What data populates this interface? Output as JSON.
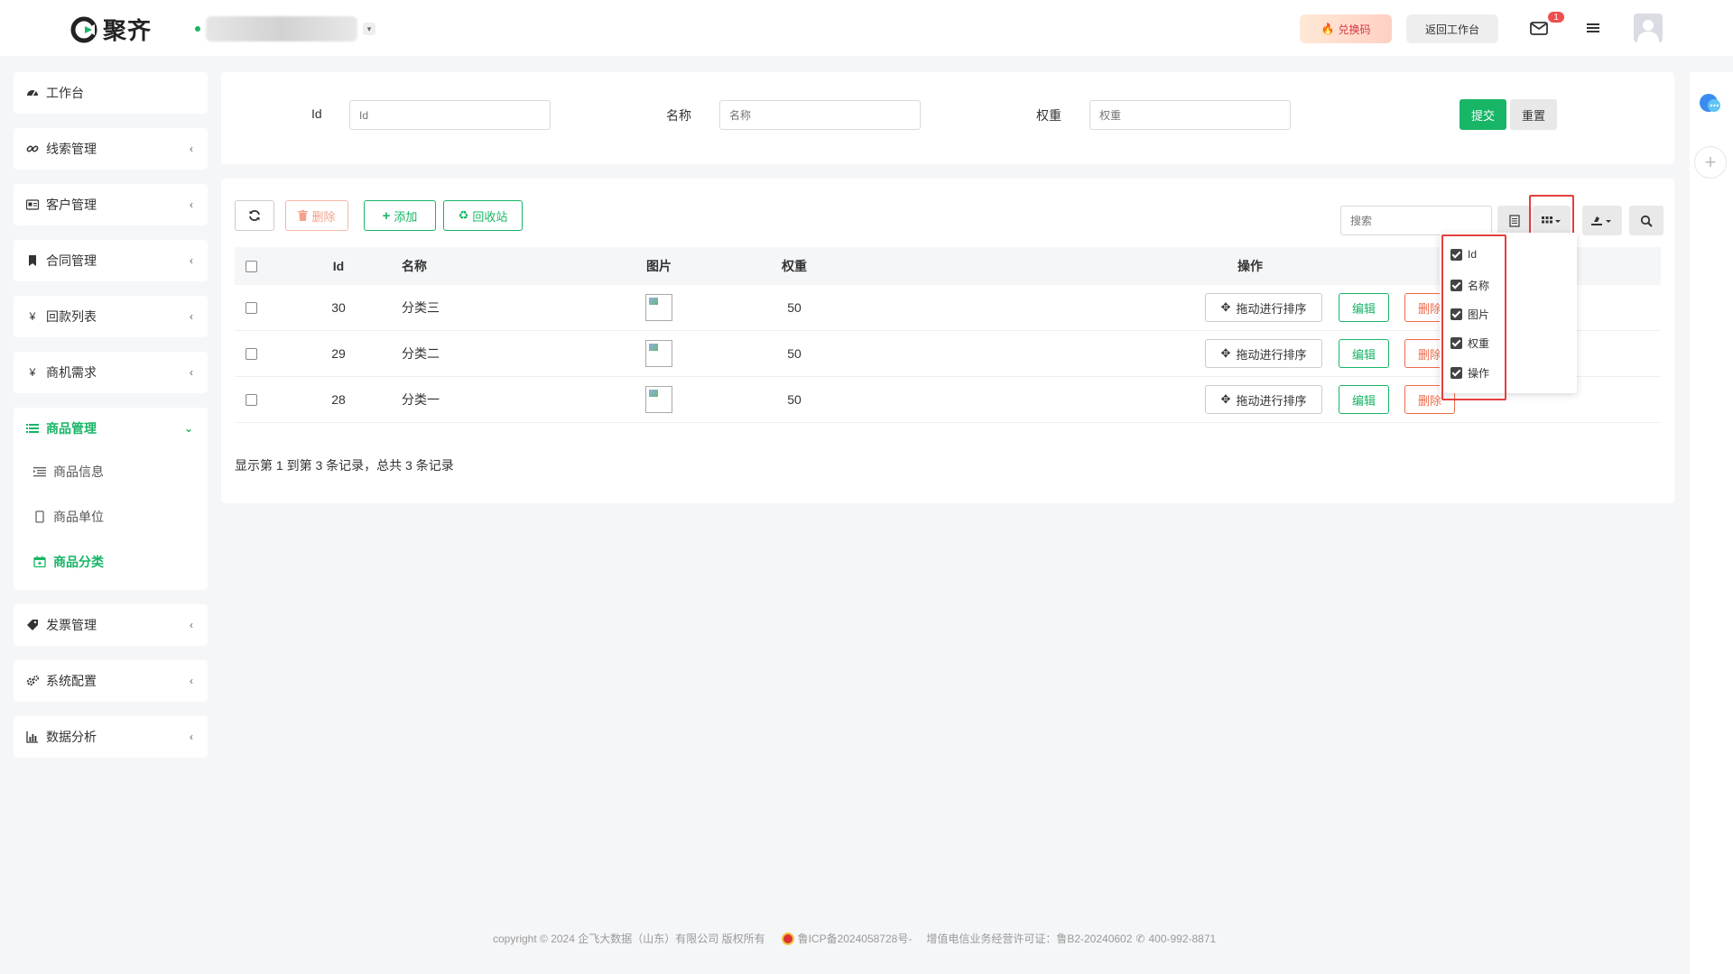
{
  "header": {
    "brand": "聚齐",
    "redeem_label": "兑换码",
    "return_label": "返回工作台",
    "mail_badge": "1"
  },
  "sidebar": {
    "items": [
      {
        "label": "工作台",
        "icon": "dashboard-icon"
      },
      {
        "label": "线索管理",
        "icon": "link-icon"
      },
      {
        "label": "客户管理",
        "icon": "id-card-icon"
      },
      {
        "label": "合同管理",
        "icon": "bookmark-icon"
      },
      {
        "label": "回款列表",
        "icon": "yen-icon"
      },
      {
        "label": "商机需求",
        "icon": "yen-icon"
      }
    ],
    "active_group": {
      "label": "商品管理",
      "icon": "list-icon",
      "children": [
        {
          "label": "商品信息",
          "icon": "indent-icon"
        },
        {
          "label": "商品单位",
          "icon": "file-icon"
        },
        {
          "label": "商品分类",
          "icon": "calendar-icon",
          "active": true
        }
      ]
    },
    "items_after": [
      {
        "label": "发票管理",
        "icon": "tag-icon"
      },
      {
        "label": "系统配置",
        "icon": "cogs-icon"
      },
      {
        "label": "数据分析",
        "icon": "bar-chart-icon"
      }
    ]
  },
  "filter": {
    "id_label": "Id",
    "id_placeholder": "Id",
    "name_label": "名称",
    "name_placeholder": "名称",
    "weight_label": "权重",
    "weight_placeholder": "权重",
    "submit_label": "提交",
    "reset_label": "重置"
  },
  "toolbar": {
    "delete_label": "删除",
    "add_label": "添加",
    "recycle_label": "回收站",
    "search_placeholder": "搜索"
  },
  "table": {
    "headers": {
      "id": "Id",
      "name": "名称",
      "picture": "图片",
      "weight": "权重",
      "operation": "操作"
    },
    "rows": [
      {
        "id": "30",
        "name": "分类三",
        "weight": "50"
      },
      {
        "id": "29",
        "name": "分类二",
        "weight": "50"
      },
      {
        "id": "28",
        "name": "分类一",
        "weight": "50"
      }
    ],
    "drag_label": "拖动进行排序",
    "edit_label": "编辑",
    "delete_label": "删除"
  },
  "pagination": {
    "info": "显示第 1 到第 3 条记录，总共 3 条记录"
  },
  "column_menu": {
    "options": [
      "Id",
      "名称",
      "图片",
      "权重",
      "操作"
    ]
  },
  "footer": {
    "copyright": "copyright © 2024 企飞大数据（山东）有限公司 版权所有",
    "icp": "鲁ICP备2024058728号-",
    "license": "增值电信业务经营许可证：鲁B2-20240602",
    "phone": "400-992-8871"
  },
  "colors": {
    "primary": "#18b566",
    "danger": "#ef6b4a",
    "highlight": "#e53e3e"
  }
}
